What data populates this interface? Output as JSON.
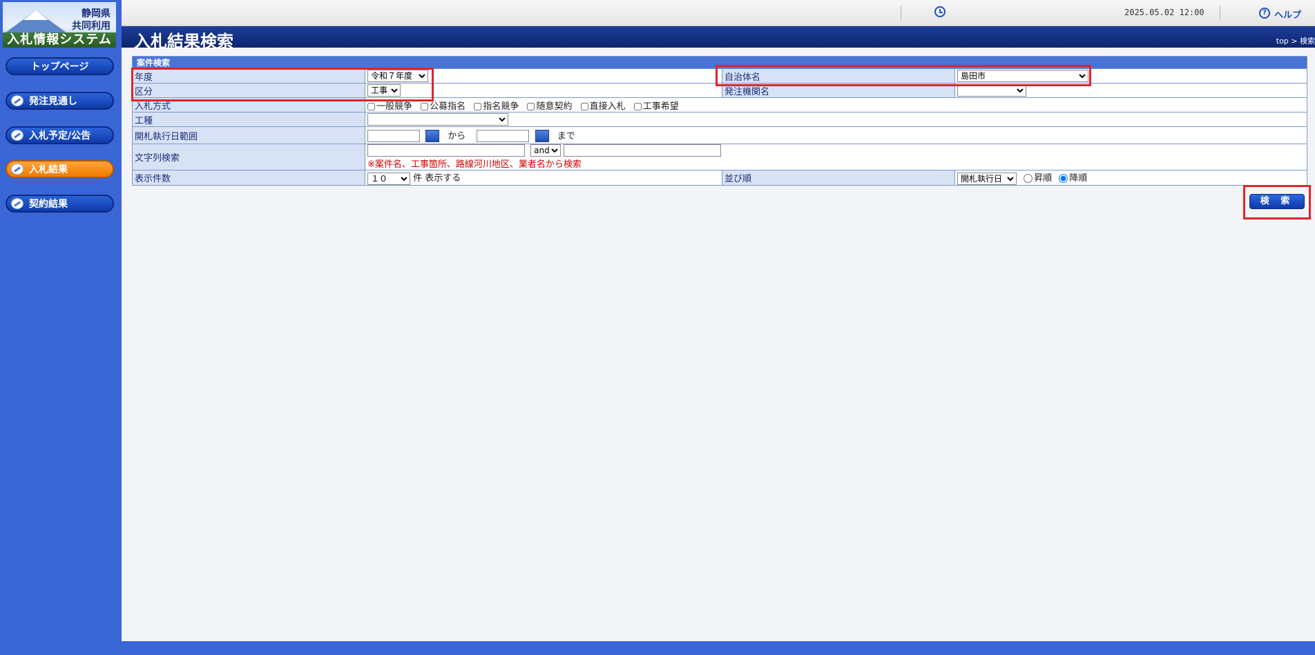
{
  "logo": {
    "line1": "静岡県",
    "line2": "共同利用",
    "line3": "入札情報システム"
  },
  "sidebar": {
    "items": [
      {
        "label": "トップページ"
      },
      {
        "label": "発注見通し"
      },
      {
        "label": "入札予定/公告"
      },
      {
        "label": "入札結果"
      },
      {
        "label": "契約結果"
      }
    ],
    "active_item": "入札結果"
  },
  "header": {
    "clock_icon": "clock-icon",
    "datetime": "2025.05.02 12:00",
    "help_icon": "help-icon",
    "help_label": "ヘルプ",
    "title": "入札結果検索",
    "breadcrumb": "top > 検索"
  },
  "form": {
    "section_title": "案件検索",
    "fields": {
      "year": {
        "label": "年度",
        "value": "令和７年度"
      },
      "municipality": {
        "label": "自治体名",
        "value": "島田市"
      },
      "division": {
        "label": "区分",
        "value": "工事"
      },
      "ordering_agency": {
        "label": "発注機関名",
        "value": ""
      },
      "bid_method": {
        "label": "入札方式",
        "options": [
          "一般競争",
          "公募指名",
          "指名競争",
          "随意契約",
          "直接入札",
          "工事希望"
        ]
      },
      "work_type": {
        "label": "工種",
        "value": ""
      },
      "opening_range": {
        "label": "開札執行日範囲",
        "from": "から",
        "to": "まで"
      },
      "text_search": {
        "label": "文字列検索",
        "operator": "and",
        "note": "※案件名、工事箇所、路線河川地区、業者名から検索"
      },
      "display_count": {
        "label": "表示件数",
        "value": "１０",
        "suffix": "件 表示する"
      },
      "sort_order": {
        "label": "並び順",
        "value": "開札執行日",
        "asc": "昇順",
        "desc": "降順",
        "selected": "降順"
      }
    },
    "search_button": "検 索"
  },
  "colors": {
    "sidebar_bg": "#3a66d6",
    "title_bar": "#0c256e",
    "active_nav": "#f07a00",
    "highlight": "#e0242b"
  }
}
